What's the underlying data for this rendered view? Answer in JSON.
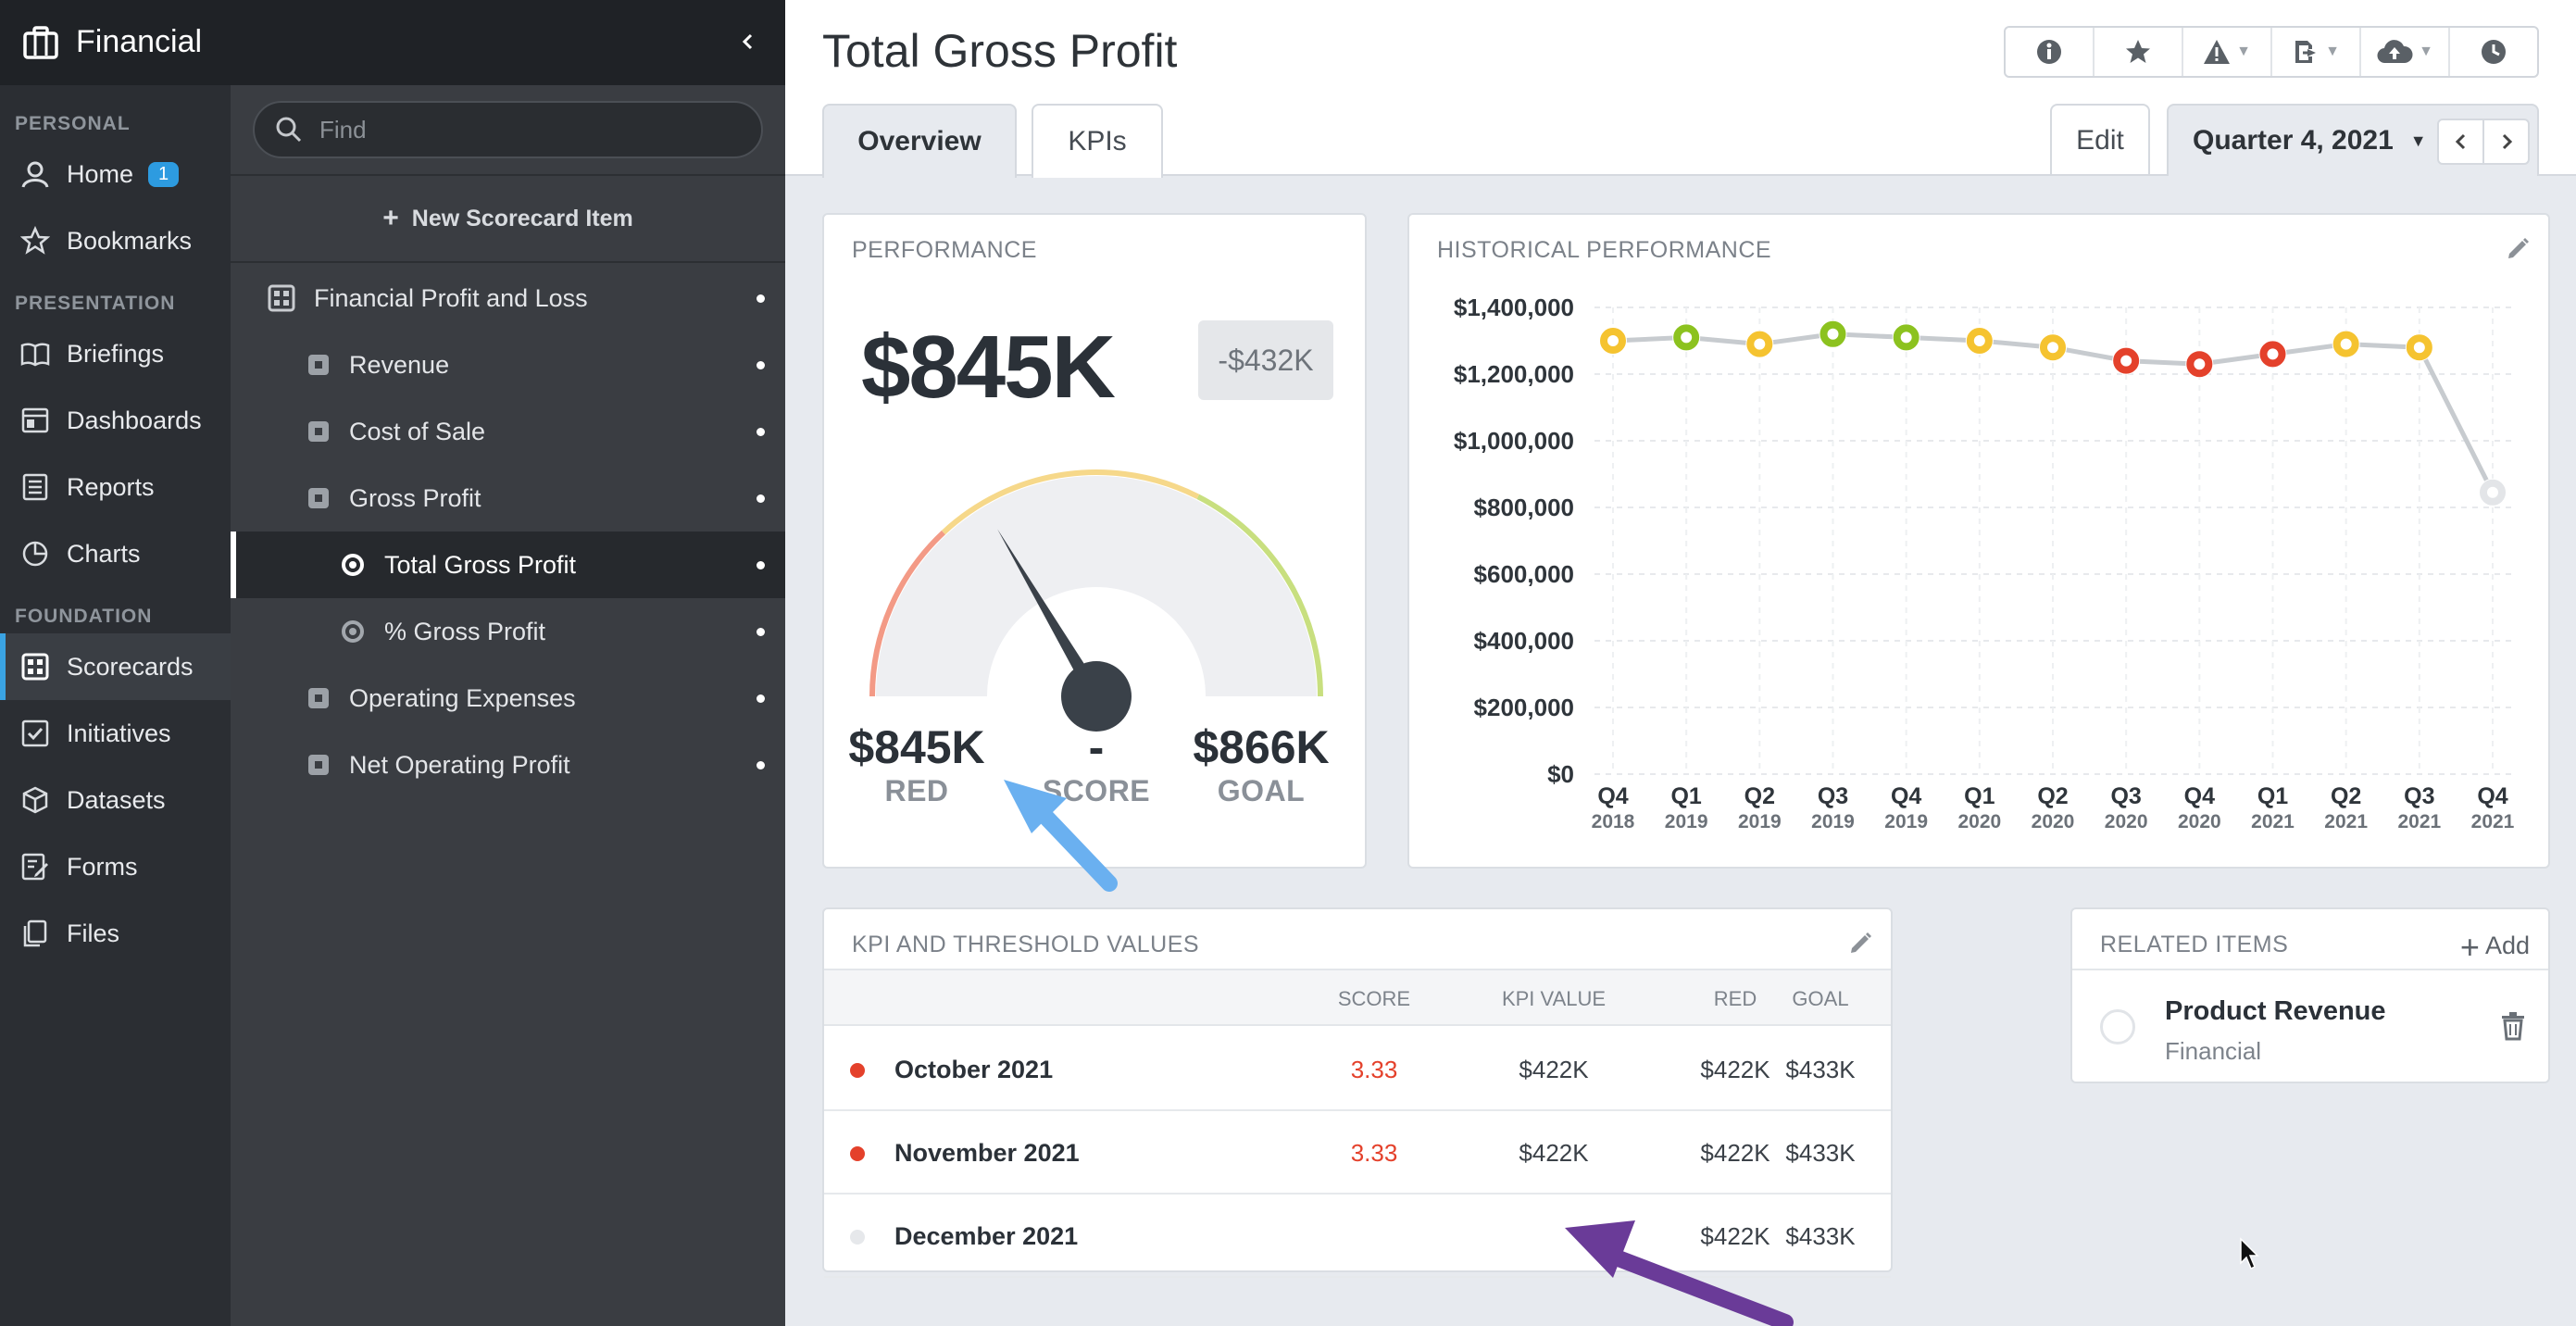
{
  "app": {
    "title": "Financial"
  },
  "nav": {
    "sections": [
      {
        "label": "PERSONAL",
        "items": [
          {
            "label": "Home",
            "icon": "user-icon",
            "badge": "1"
          },
          {
            "label": "Bookmarks",
            "icon": "star-icon"
          }
        ]
      },
      {
        "label": "PRESENTATION",
        "items": [
          {
            "label": "Briefings",
            "icon": "book-icon"
          },
          {
            "label": "Dashboards",
            "icon": "dashboard-icon"
          },
          {
            "label": "Reports",
            "icon": "report-icon"
          },
          {
            "label": "Charts",
            "icon": "pie-chart-icon"
          }
        ]
      },
      {
        "label": "FOUNDATION",
        "items": [
          {
            "label": "Scorecards",
            "icon": "scorecard-icon",
            "active": true
          },
          {
            "label": "Initiatives",
            "icon": "checkbox-icon"
          },
          {
            "label": "Datasets",
            "icon": "cube-icon"
          },
          {
            "label": "Forms",
            "icon": "form-icon"
          },
          {
            "label": "Files",
            "icon": "files-icon"
          }
        ]
      }
    ]
  },
  "tree": {
    "search_placeholder": "Find",
    "new_item_label": "New Scorecard Item",
    "items": [
      {
        "label": "Financial Profit and Loss",
        "type": "scorecard",
        "level": 0
      },
      {
        "label": "Revenue",
        "type": "objective",
        "level": 1
      },
      {
        "label": "Cost of Sale",
        "type": "objective",
        "level": 1
      },
      {
        "label": "Gross Profit",
        "type": "objective",
        "level": 1
      },
      {
        "label": "Total Gross Profit",
        "type": "kpi",
        "level": 2,
        "selected": true
      },
      {
        "label": "% Gross Profit",
        "type": "kpi",
        "level": 2
      },
      {
        "label": "Operating Expenses",
        "type": "objective",
        "level": 1
      },
      {
        "label": "Net Operating Profit",
        "type": "objective",
        "level": 1
      }
    ]
  },
  "header": {
    "title": "Total Gross Profit",
    "tabs": [
      {
        "label": "Overview",
        "active": true
      },
      {
        "label": "KPIs"
      }
    ],
    "edit_label": "Edit",
    "period_label": "Quarter 4, 2021",
    "toolbar_icons": [
      "info-icon",
      "star-icon",
      "alert-icon",
      "export-icon",
      "cloud-upload-icon",
      "history-icon"
    ]
  },
  "performance": {
    "title": "PERFORMANCE",
    "value": "$845K",
    "delta": "-$432K",
    "red_value": "$845K",
    "red_label": "RED",
    "score_value": "-",
    "score_label": "SCORE",
    "goal_value": "$866K",
    "goal_label": "GOAL",
    "gauge_fraction": 0.33
  },
  "history": {
    "title": "HISTORICAL PERFORMANCE",
    "chart_data": {
      "type": "line",
      "x": [
        [
          "Q4",
          "2018"
        ],
        [
          "Q1",
          "2019"
        ],
        [
          "Q2",
          "2019"
        ],
        [
          "Q3",
          "2019"
        ],
        [
          "Q4",
          "2019"
        ],
        [
          "Q1",
          "2020"
        ],
        [
          "Q2",
          "2020"
        ],
        [
          "Q3",
          "2020"
        ],
        [
          "Q4",
          "2020"
        ],
        [
          "Q1",
          "2021"
        ],
        [
          "Q2",
          "2021"
        ],
        [
          "Q3",
          "2021"
        ],
        [
          "Q4",
          "2021"
        ]
      ],
      "values": [
        1300000,
        1310000,
        1290000,
        1320000,
        1310000,
        1300000,
        1280000,
        1240000,
        1230000,
        1260000,
        1290000,
        1280000,
        845000
      ],
      "status": [
        "yellow",
        "green",
        "yellow",
        "green",
        "green",
        "yellow",
        "yellow",
        "red",
        "red",
        "red",
        "yellow",
        "yellow",
        "none"
      ],
      "ylim": [
        0,
        1400000
      ],
      "yticks": [
        "$0",
        "$200,000",
        "$400,000",
        "$600,000",
        "$800,000",
        "$1,000,000",
        "$1,200,000",
        "$1,400,000"
      ],
      "grid": true,
      "colors": {
        "green": "#8cc21f",
        "yellow": "#f5c330",
        "red": "#e4412b",
        "none": "#e3e5e8",
        "line": "#c7cbcf"
      }
    }
  },
  "kpi_table": {
    "title": "KPI AND THRESHOLD VALUES",
    "columns": [
      "SCORE",
      "KPI VALUE",
      "RED",
      "GOAL"
    ],
    "rows": [
      {
        "name": "October 2021",
        "score": "3.33",
        "kpi": "$422K",
        "red": "$422K",
        "goal": "$433K",
        "status_color": "#e4412b"
      },
      {
        "name": "November 2021",
        "score": "3.33",
        "kpi": "$422K",
        "red": "$422K",
        "goal": "$433K",
        "status_color": "#e4412b"
      },
      {
        "name": "December 2021",
        "score": "",
        "kpi": "",
        "red": "$422K",
        "goal": "$433K",
        "status_color": "#e6e8eb"
      }
    ]
  },
  "related": {
    "title": "RELATED ITEMS",
    "add_label": "Add",
    "items": [
      {
        "name": "Product Revenue",
        "sub": "Financial"
      }
    ]
  }
}
